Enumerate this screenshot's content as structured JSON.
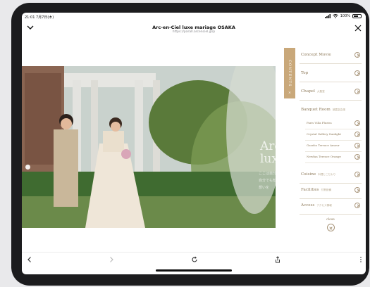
{
  "status_bar": {
    "time": "21:01  7月7日(木)",
    "battery": "100%"
  },
  "browser": {
    "title": "Arc-en-Ciel luxe mariage OSAKA",
    "url": "https://parall.arcenciel.jp/p"
  },
  "menu": {
    "tab_label": "CONTENTS",
    "tab_close": "×",
    "items": [
      {
        "label": "Concept Movie",
        "sub": ""
      },
      {
        "label": "Top",
        "sub": ""
      },
      {
        "label": "Chapel",
        "sub": "大聖堂"
      }
    ],
    "banquet": {
      "label": "Banquet Room",
      "sub": "披露宴会場"
    },
    "sub_items": [
      {
        "label": "Paris Villa Fluriss"
      },
      {
        "label": "Crystal Gallery Sunlight"
      },
      {
        "label": "Gazebo Terrace Amour"
      },
      {
        "label": "Newfan Terrace Orange"
      }
    ],
    "items_after": [
      {
        "label": "Cuisine",
        "sub": "料理とこだわり"
      },
      {
        "label": "Facilities",
        "sub": "付帯設備"
      },
      {
        "label": "Access",
        "sub": "アクセス情報"
      }
    ],
    "close_label": "close"
  },
  "hero": {
    "overlay_title_line1": "Arc-en-Ciel",
    "overlay_title_line2": "luxe mariage",
    "overlay_sub_line1": "ここは自分",
    "overlay_sub_line2": "自分でも知ら",
    "overlay_sub_line3": "想いを"
  },
  "colors": {
    "accent": "#c9a87a",
    "menu_text": "#8e7a5a"
  },
  "icons": [
    "chevron-down-icon",
    "close-icon",
    "back-icon",
    "forward-icon",
    "reload-icon",
    "share-icon",
    "more-icon"
  ]
}
